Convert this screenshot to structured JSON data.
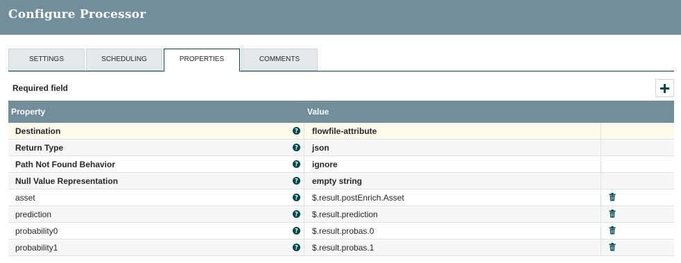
{
  "dialog": {
    "title": "Configure Processor"
  },
  "tabs": [
    {
      "label": "SETTINGS",
      "selected": false
    },
    {
      "label": "SCHEDULING",
      "selected": false
    },
    {
      "label": "PROPERTIES",
      "selected": true
    },
    {
      "label": "COMMENTS",
      "selected": false
    }
  ],
  "properties_panel": {
    "required_label": "Required field",
    "add_button_icon": "plus-icon",
    "columns": {
      "property": "Property",
      "value": "Value"
    },
    "rows": [
      {
        "name": "Destination",
        "value": "flowfile-attribute",
        "required": true,
        "selected": true,
        "deletable": false
      },
      {
        "name": "Return Type",
        "value": "json",
        "required": true,
        "selected": false,
        "deletable": false
      },
      {
        "name": "Path Not Found Behavior",
        "value": "ignore",
        "required": true,
        "selected": false,
        "deletable": false
      },
      {
        "name": "Null Value Representation",
        "value": "empty string",
        "required": true,
        "selected": false,
        "deletable": false
      },
      {
        "name": "asset",
        "value": "$.result.postEnrich.Asset",
        "required": false,
        "selected": false,
        "deletable": true
      },
      {
        "name": "prediction",
        "value": "$.result.prediction",
        "required": false,
        "selected": false,
        "deletable": true
      },
      {
        "name": "probability0",
        "value": "$.result.probas.0",
        "required": false,
        "selected": false,
        "deletable": true
      },
      {
        "name": "probability1",
        "value": "$.result.probas.1",
        "required": false,
        "selected": false,
        "deletable": true
      }
    ]
  },
  "colors": {
    "header_bg": "#728e9b",
    "accent": "#004849",
    "selected_row": "#fdfaec",
    "icon": "#004849"
  }
}
